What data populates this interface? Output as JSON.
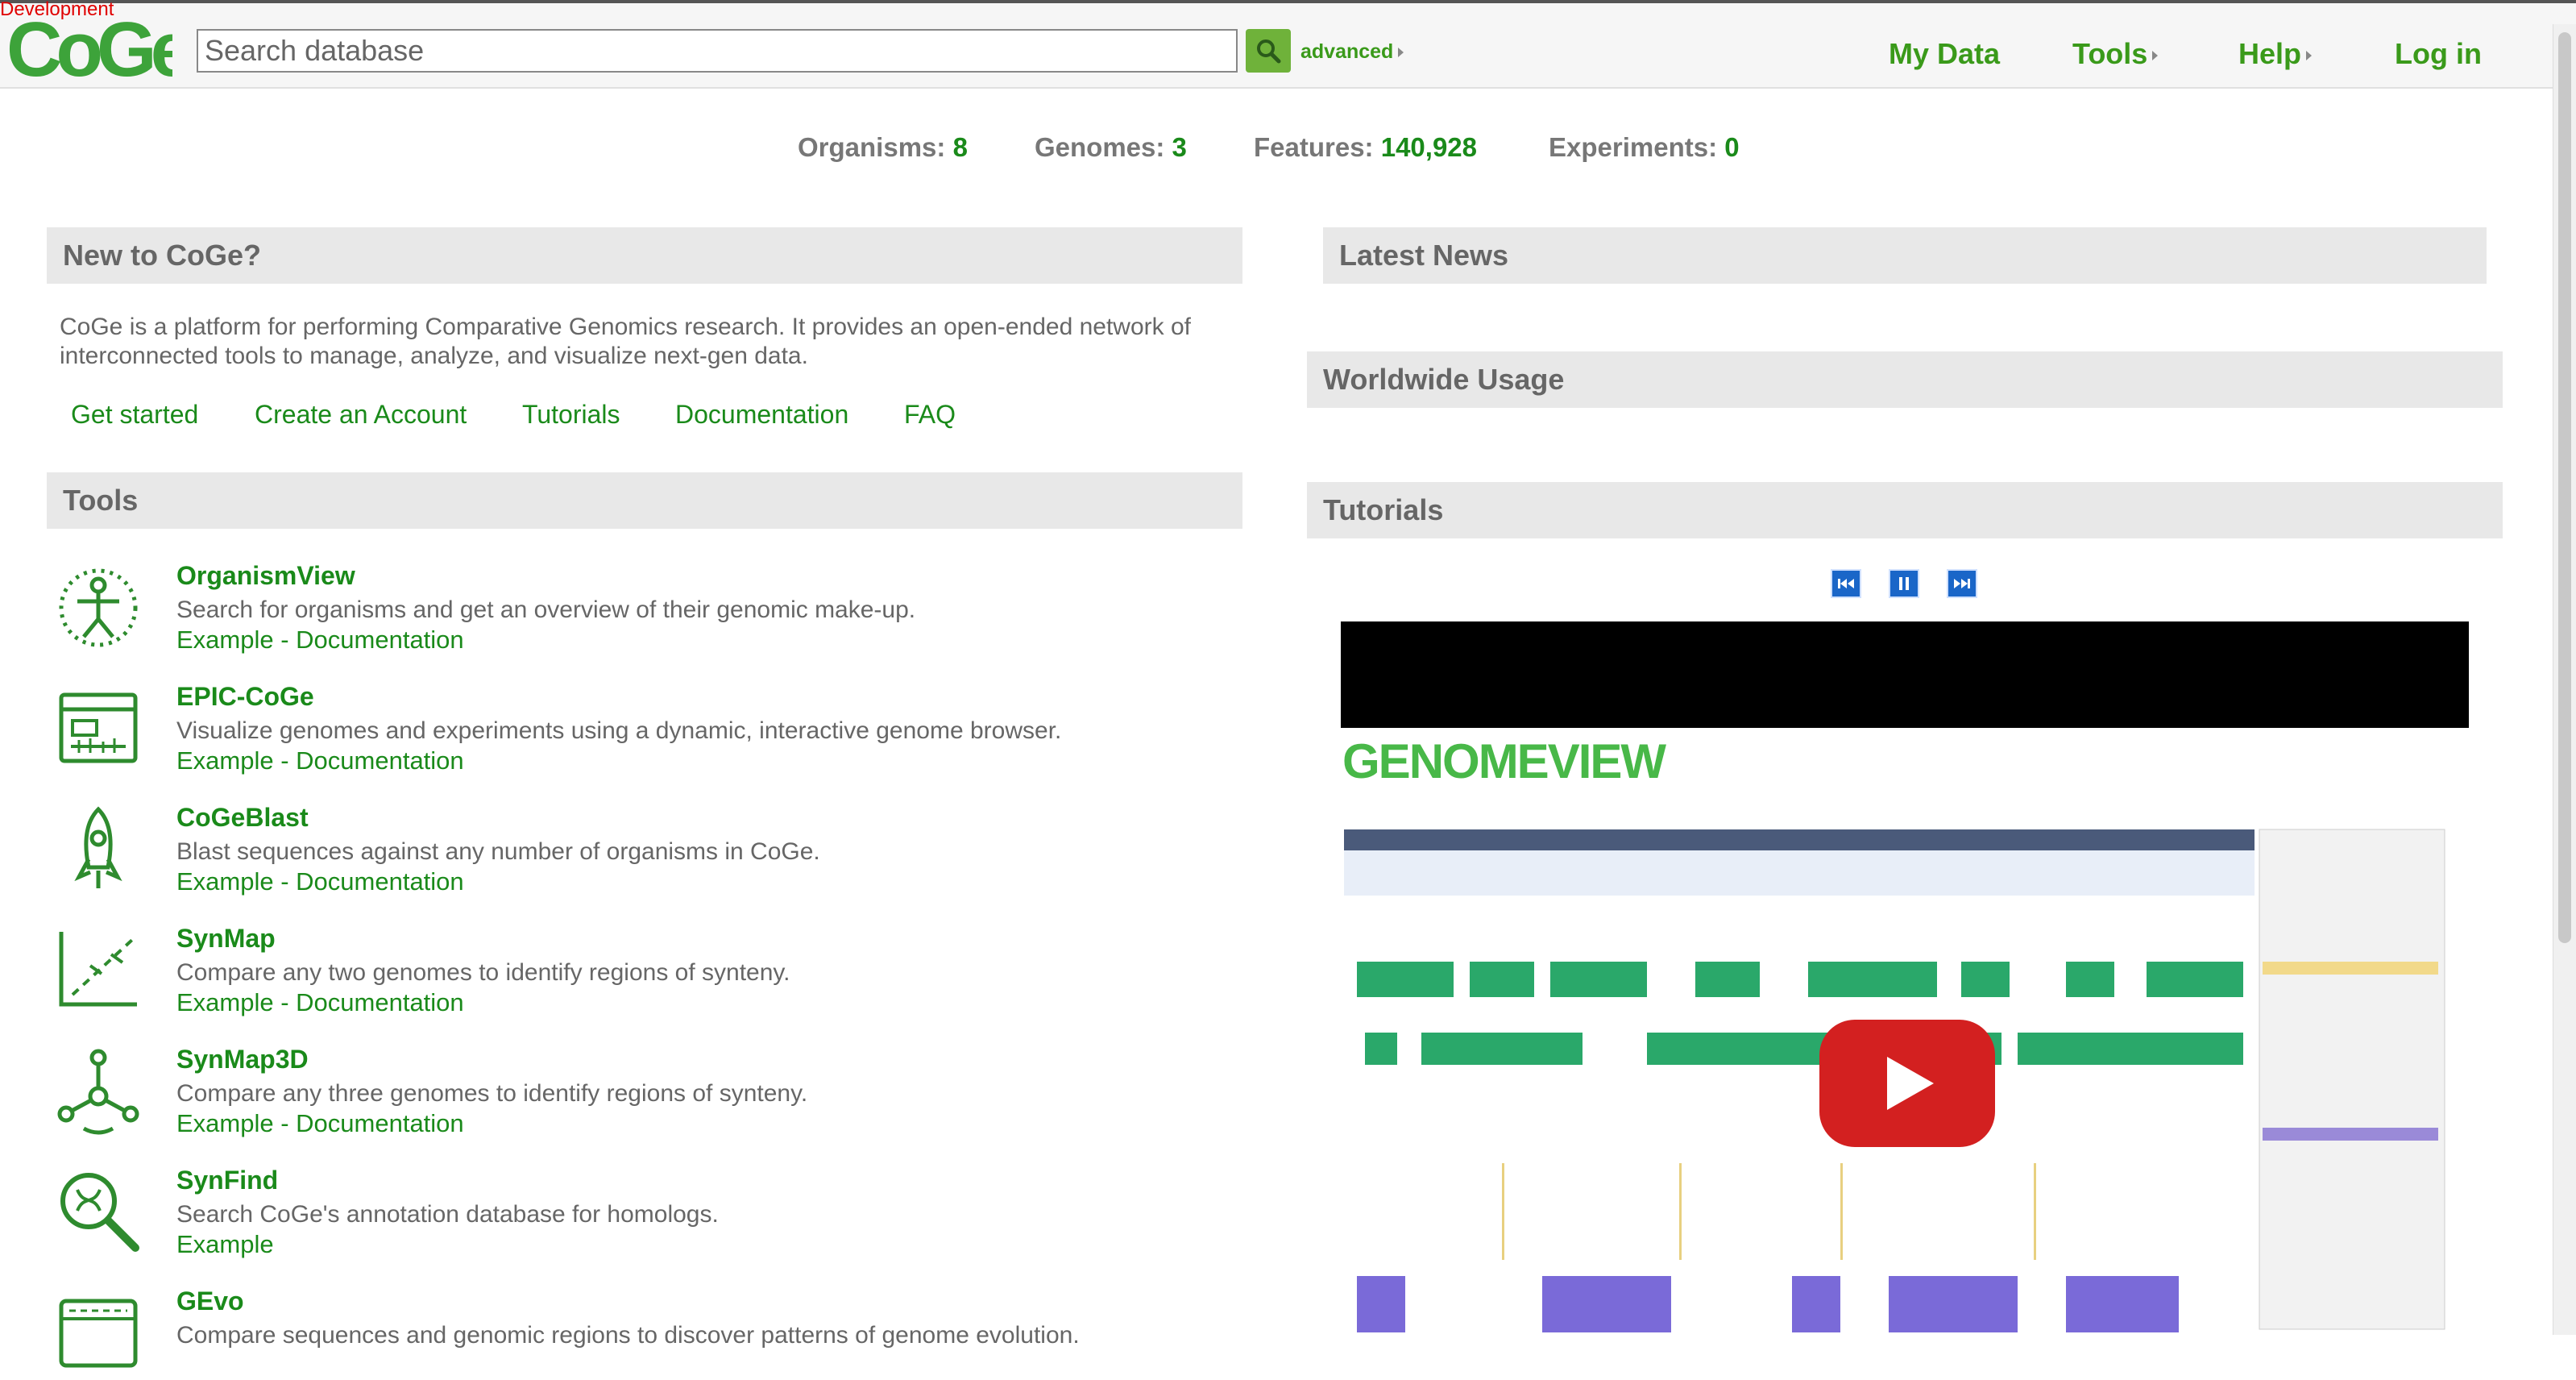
{
  "app": {
    "env_label": "Development"
  },
  "header": {
    "search_placeholder": "Search database",
    "advanced_label": "advanced",
    "nav": {
      "my_data": "My Data",
      "tools": "Tools",
      "help": "Help",
      "login": "Log in"
    }
  },
  "stats": [
    {
      "label": "Organisms: ",
      "value": "8"
    },
    {
      "label": "Genomes: ",
      "value": "3"
    },
    {
      "label": "Features: ",
      "value": "140,928"
    },
    {
      "label": "Experiments: ",
      "value": "0"
    }
  ],
  "intro": {
    "heading": "New to CoGe?",
    "text": "CoGe is a platform for performing Comparative Genomics research. It provides an open-ended network of interconnected tools to manage, analyze, and visualize next-gen data.",
    "links": [
      "Get started",
      "Create an Account",
      "Tutorials",
      "Documentation",
      "FAQ"
    ]
  },
  "tools_section": {
    "heading": "Tools",
    "items": [
      {
        "title": "OrganismView",
        "desc": "Search for organisms and get an overview of their genomic make-up.",
        "links": "Example - Documentation",
        "icon": "organism-icon"
      },
      {
        "title": "EPIC-CoGe",
        "desc": "Visualize genomes and experiments using a dynamic, interactive genome browser.",
        "links": "Example - Documentation",
        "icon": "browser-icon"
      },
      {
        "title": "CoGeBlast",
        "desc": "Blast sequences against any number of organisms in CoGe.",
        "links": "Example - Documentation",
        "icon": "rocket-icon"
      },
      {
        "title": "SynMap",
        "desc": "Compare any two genomes to identify regions of synteny.",
        "links": "Example - Documentation",
        "icon": "dotplot-icon"
      },
      {
        "title": "SynMap3D",
        "desc": "Compare any three genomes to identify regions of synteny.",
        "links": "Example - Documentation",
        "icon": "network-icon"
      },
      {
        "title": "SynFind",
        "desc": "Search CoGe's annotation database for homologs.",
        "links": "Example",
        "icon": "magnifier-icon"
      },
      {
        "title": "GEvo",
        "desc": "Compare sequences and genomic regions to discover patterns of genome evolution.",
        "links": "",
        "icon": "gevo-icon"
      }
    ]
  },
  "right": {
    "news_heading": "Latest News",
    "usage_heading": "Worldwide Usage",
    "tutorials_heading": "Tutorials"
  },
  "colors": {
    "accent": "#1a8a1a",
    "nav_green": "#3a9a1a",
    "header_bg": "#e8e8e8",
    "play_red": "#d32020"
  }
}
